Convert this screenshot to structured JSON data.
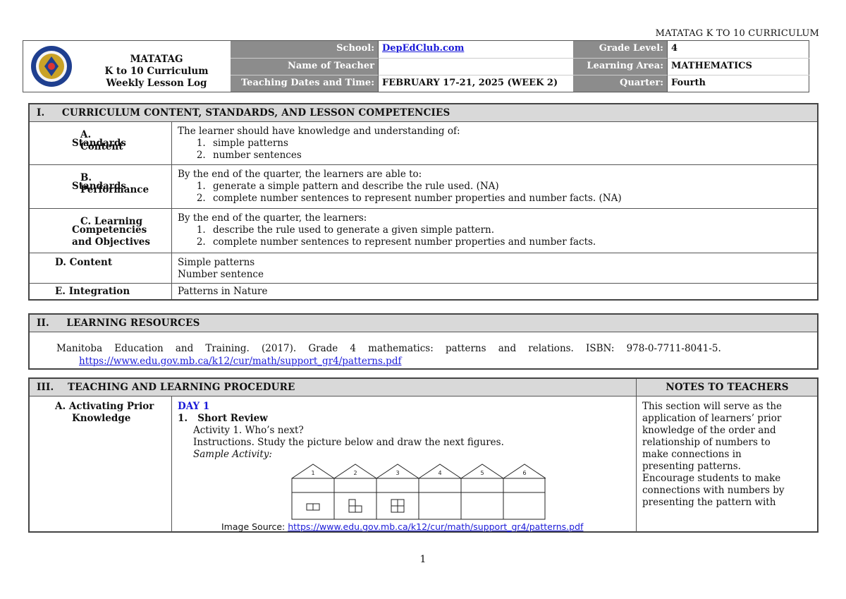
{
  "header_right": "MATATAG K TO 10 CURRICULUM",
  "brand": {
    "line1": "MATATAG",
    "line2": "K to 10 Curriculum",
    "line3": "Weekly Lesson Log",
    "seal_icon": "deped-seal-icon"
  },
  "info": {
    "school_label": "School:",
    "school_value": "DepEdClub.com",
    "grade_label": "Grade Level:",
    "grade_value": "4",
    "teacher_label": "Name of Teacher",
    "teacher_value": "",
    "area_label": "Learning Area:",
    "area_value": "MATHEMATICS",
    "dates_label": "Teaching Dates and Time:",
    "dates_value": "FEBRUARY 17-21, 2025 (WEEK 2)",
    "quarter_label": "Quarter:",
    "quarter_value": "Fourth"
  },
  "section1": {
    "title": "I.     CURRICULUM CONTENT, STANDARDS, AND LESSON COMPETENCIES",
    "rows": [
      {
        "key_line1": "A.  Content",
        "key_line2": "Standards",
        "intro": "The learner should have knowledge and understanding of:",
        "items": [
          "simple patterns",
          "number sentences"
        ]
      },
      {
        "key_line1": "B.  Performance",
        "key_line2": "Standards",
        "intro": "By the end of the quarter, the learners are able to:",
        "items": [
          "generate a simple pattern and describe the rule used. (NA)",
          "complete number sentences to represent number properties and number facts. (NA)"
        ]
      },
      {
        "key_line1": "C.  Learning",
        "key_line2": "Competencies",
        "key_line3": "and Objectives",
        "intro": "By the end of the quarter, the learners:",
        "items": [
          "describe the rule used to generate a given simple pattern.",
          "complete number sentences to represent number properties and number facts."
        ]
      },
      {
        "key_line1": "D.  Content",
        "lines": [
          "Simple patterns",
          "Number sentence"
        ]
      },
      {
        "key_line1": "E.  Integration",
        "lines": [
          "Patterns in Nature"
        ]
      }
    ]
  },
  "section2": {
    "title": "II.     LEARNING RESOURCES",
    "citation": "Manitoba    Education    and    Training.    (2017).    Grade    4    mathematics:    patterns    and    relations.    ISBN:    978-0-7711-8041-5.",
    "url": "https://www.edu.gov.mb.ca/k12/cur/math/support_gr4/patterns.pdf"
  },
  "section3": {
    "title": "III.    TEACHING AND LEARNING PROCEDURE",
    "notes_title": "NOTES TO TEACHERS",
    "row_key_line1": "A.  Activating Prior",
    "row_key_line2": "Knowledge",
    "day": "DAY 1",
    "step": "1.   Short Review",
    "activity": "Activity 1. Who’s next?",
    "instructions": "Instructions. Study the picture below and draw the next figures.",
    "sample": "Sample Activity:",
    "houses": [
      "1",
      "2",
      "3",
      "4",
      "5",
      "6"
    ],
    "image_source_label": "Image Source: ",
    "image_source_url": "https://www.edu.gov.mb.ca/k12/cur/math/support_gr4/patterns.pdf",
    "notes": [
      "This section will serve as the",
      "application of learners’ prior",
      "knowledge of the order and",
      "relationship of numbers to",
      "make connections in",
      "presenting patterns.",
      "Encourage students to make",
      "connections with numbers by",
      "presenting the pattern with"
    ]
  },
  "page_number": "1"
}
